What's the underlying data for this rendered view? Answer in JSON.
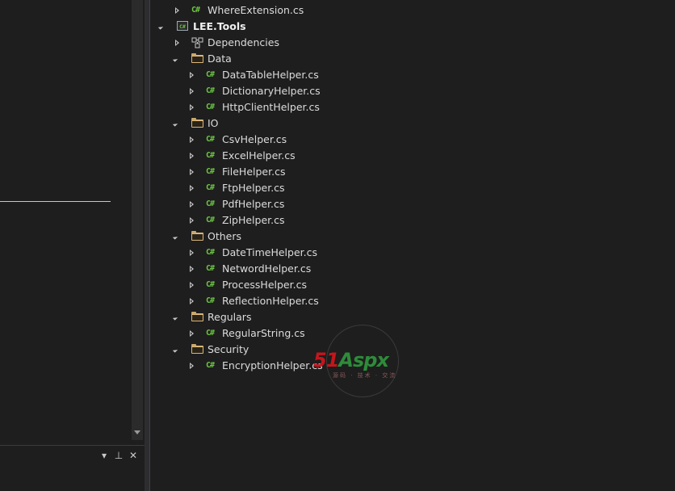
{
  "icons": {
    "collapsed_arrow": "chevron-right-icon",
    "expanded_arrow": "chevron-down-icon",
    "cs_file": "csharp-file-icon",
    "folder": "folder-icon",
    "project": "csharp-project-icon",
    "dependencies": "dependencies-icon",
    "pin": "pin-icon",
    "close": "close-icon",
    "dropdown": "dropdown-arrow-icon"
  },
  "colors": {
    "background": "#1e1e1e",
    "cs_icon": "#6cc644",
    "folder": "#dcb67a",
    "text": "#dcdcdc",
    "watermark_red": "#c4161c",
    "watermark_green": "#2e8b3a"
  },
  "bottom_panel": {
    "dropdown_glyph": "▾",
    "pin_glyph": "⊥",
    "close_glyph": "✕"
  },
  "tree": {
    "cs_glyph": "C#",
    "project_glyph": "C#",
    "nodes": [
      {
        "label": "WhereExtension.cs",
        "type": "cs",
        "depth": 2,
        "state": "collapsed"
      },
      {
        "label": "LEE.Tools",
        "type": "project",
        "depth": 1,
        "state": "expanded"
      },
      {
        "label": "Dependencies",
        "type": "dependencies",
        "depth": 2,
        "state": "collapsed"
      },
      {
        "label": "Data",
        "type": "folder",
        "depth": 2,
        "state": "expanded"
      },
      {
        "label": "DataTableHelper.cs",
        "type": "cs",
        "depth": 3,
        "state": "collapsed"
      },
      {
        "label": "DictionaryHelper.cs",
        "type": "cs",
        "depth": 3,
        "state": "collapsed"
      },
      {
        "label": "HttpClientHelper.cs",
        "type": "cs",
        "depth": 3,
        "state": "collapsed"
      },
      {
        "label": "IO",
        "type": "folder",
        "depth": 2,
        "state": "expanded"
      },
      {
        "label": "CsvHelper.cs",
        "type": "cs",
        "depth": 3,
        "state": "collapsed"
      },
      {
        "label": "ExcelHelper.cs",
        "type": "cs",
        "depth": 3,
        "state": "collapsed"
      },
      {
        "label": "FileHelper.cs",
        "type": "cs",
        "depth": 3,
        "state": "collapsed"
      },
      {
        "label": "FtpHelper.cs",
        "type": "cs",
        "depth": 3,
        "state": "collapsed"
      },
      {
        "label": "PdfHelper.cs",
        "type": "cs",
        "depth": 3,
        "state": "collapsed"
      },
      {
        "label": "ZipHelper.cs",
        "type": "cs",
        "depth": 3,
        "state": "collapsed"
      },
      {
        "label": "Others",
        "type": "folder",
        "depth": 2,
        "state": "expanded"
      },
      {
        "label": "DateTimeHelper.cs",
        "type": "cs",
        "depth": 3,
        "state": "collapsed"
      },
      {
        "label": "NetwordHelper.cs",
        "type": "cs",
        "depth": 3,
        "state": "collapsed"
      },
      {
        "label": "ProcessHelper.cs",
        "type": "cs",
        "depth": 3,
        "state": "collapsed"
      },
      {
        "label": "ReflectionHelper.cs",
        "type": "cs",
        "depth": 3,
        "state": "collapsed"
      },
      {
        "label": "Regulars",
        "type": "folder",
        "depth": 2,
        "state": "expanded"
      },
      {
        "label": "RegularString.cs",
        "type": "cs",
        "depth": 3,
        "state": "collapsed"
      },
      {
        "label": "Security",
        "type": "folder",
        "depth": 2,
        "state": "expanded"
      },
      {
        "label": "EncryptionHelper.cs",
        "type": "cs",
        "depth": 3,
        "state": "collapsed"
      }
    ]
  },
  "watermark": {
    "logo_number": "51",
    "logo_text": "Aspx",
    "subtitle": "源码 · 技术 · 交流"
  }
}
